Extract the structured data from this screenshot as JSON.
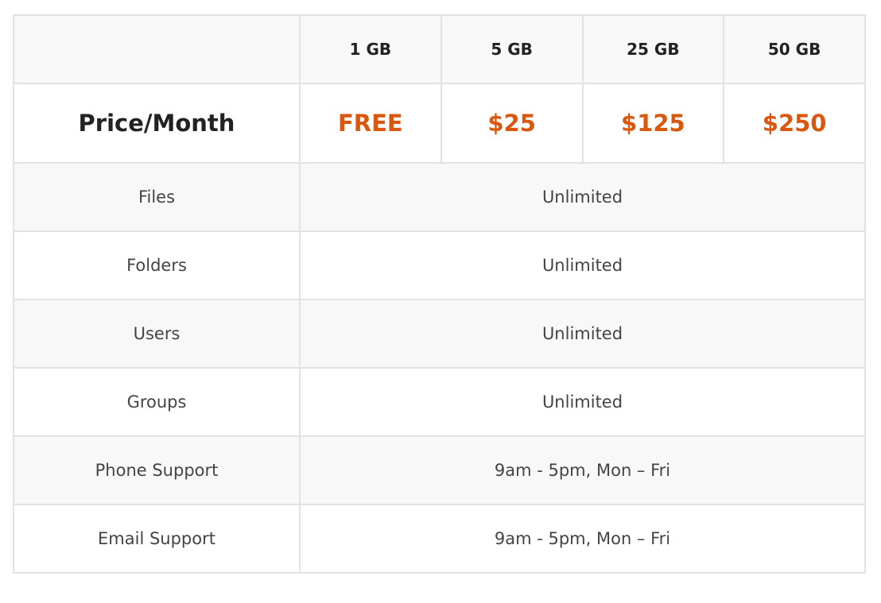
{
  "theme": {
    "price_color": "#d9570f",
    "border_color": "#e2e2e2",
    "shaded_row_bg": "#f8f8f8"
  },
  "table": {
    "corner_label": "",
    "tiers": [
      "1 GB",
      "5 GB",
      "25 GB",
      "50 GB"
    ],
    "price_row": {
      "label": "Price/Month",
      "values": [
        "FREE",
        "$25",
        "$125",
        "$250"
      ]
    },
    "features": [
      {
        "label": "Files",
        "value": "Unlimited"
      },
      {
        "label": "Folders",
        "value": "Unlimited"
      },
      {
        "label": "Users",
        "value": "Unlimited"
      },
      {
        "label": "Groups",
        "value": "Unlimited"
      },
      {
        "label": "Phone Support",
        "value": "9am - 5pm, Mon – Fri"
      },
      {
        "label": "Email Support",
        "value": "9am - 5pm, Mon – Fri"
      }
    ]
  }
}
